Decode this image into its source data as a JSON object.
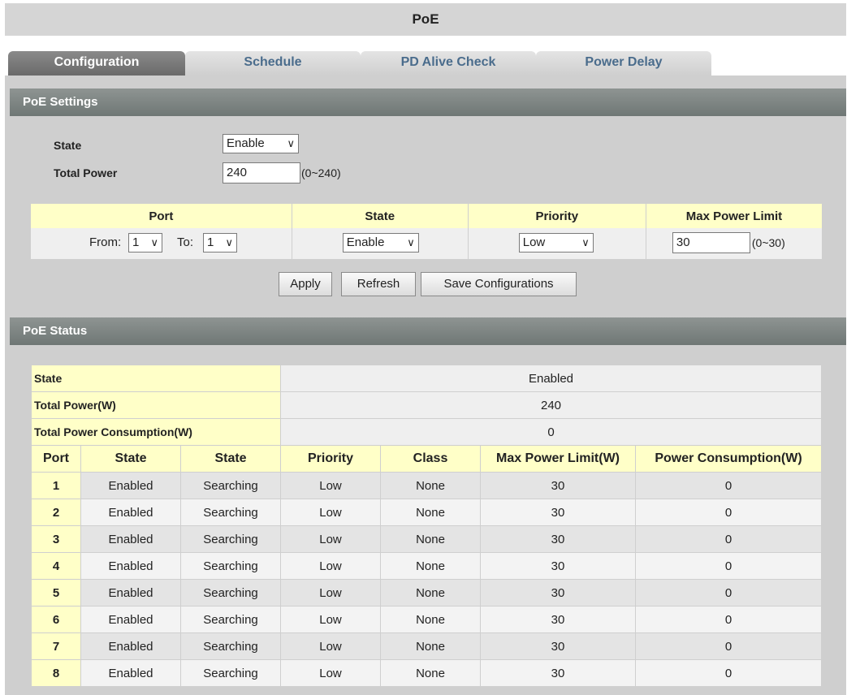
{
  "page": {
    "title": "PoE"
  },
  "tabs": [
    {
      "label": "Configuration"
    },
    {
      "label": "Schedule"
    },
    {
      "label": "PD Alive Check"
    },
    {
      "label": "Power Delay"
    }
  ],
  "settings": {
    "header": "PoE Settings",
    "state_label": "State",
    "state_value": "Enable",
    "total_power_label": "Total Power",
    "total_power_value": "240",
    "total_power_range": "(0~240)"
  },
  "port_config": {
    "headers": [
      "Port",
      "State",
      "Priority",
      "Max Power Limit"
    ],
    "from_label": "From:",
    "from_value": "1",
    "to_label": "To:",
    "to_value": "1",
    "state_value": "Enable",
    "priority_value": "Low",
    "max_power_value": "30",
    "max_power_range": "(0~30)"
  },
  "buttons": {
    "apply": "Apply",
    "refresh": "Refresh",
    "save": "Save Configurations"
  },
  "status": {
    "header": "PoE Status",
    "summary": [
      {
        "key": "State",
        "value": "Enabled"
      },
      {
        "key": "Total Power(W)",
        "value": "240"
      },
      {
        "key": "Total Power Consumption(W)",
        "value": "0"
      }
    ],
    "columns": [
      "Port",
      "State",
      "State",
      "Priority",
      "Class",
      "Max Power Limit(W)",
      "Power Consumption(W)"
    ],
    "rows": [
      [
        "1",
        "Enabled",
        "Searching",
        "Low",
        "None",
        "30",
        "0"
      ],
      [
        "2",
        "Enabled",
        "Searching",
        "Low",
        "None",
        "30",
        "0"
      ],
      [
        "3",
        "Enabled",
        "Searching",
        "Low",
        "None",
        "30",
        "0"
      ],
      [
        "4",
        "Enabled",
        "Searching",
        "Low",
        "None",
        "30",
        "0"
      ],
      [
        "5",
        "Enabled",
        "Searching",
        "Low",
        "None",
        "30",
        "0"
      ],
      [
        "6",
        "Enabled",
        "Searching",
        "Low",
        "None",
        "30",
        "0"
      ],
      [
        "7",
        "Enabled",
        "Searching",
        "Low",
        "None",
        "30",
        "0"
      ],
      [
        "8",
        "Enabled",
        "Searching",
        "Low",
        "None",
        "30",
        "0"
      ]
    ]
  },
  "icons": {
    "dropdown": "chevron-down-icon"
  }
}
